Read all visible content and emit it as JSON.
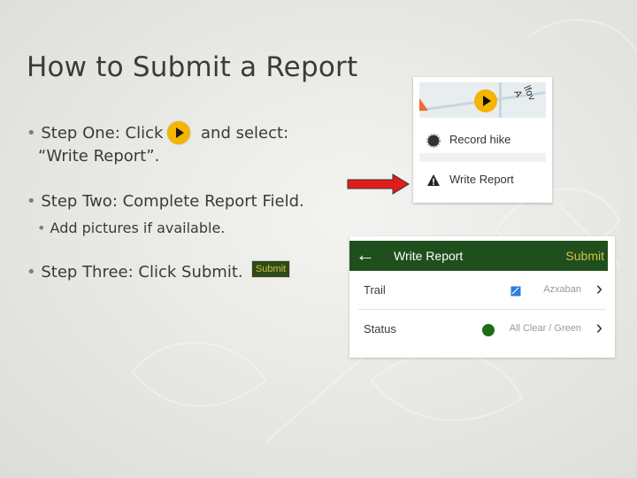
{
  "slide": {
    "title": "How to Submit a Report",
    "bullet_glyph": "•",
    "step_one_prefix": "Step One: Click",
    "step_one_suffix": "and select:",
    "step_one_line2": "“Write Report”.",
    "step_two": "Step Two: Complete Report Field.",
    "step_two_sub": "Add pictures if available.",
    "step_three": "Step Three: Click Submit.",
    "inline_submit_label": "Submit"
  },
  "map_menu": {
    "street_text": "lfov A",
    "items": [
      {
        "label": "Record hike",
        "icon": "record-icon"
      },
      {
        "label": "Write Report",
        "icon": "warning-icon"
      }
    ]
  },
  "write_report": {
    "back_glyph": "←",
    "title": "Write Report",
    "submit_label": "Submit",
    "rows": [
      {
        "label": "Trail",
        "value": "Azxaban",
        "chevron": "›"
      },
      {
        "label": "Status",
        "value": "All Clear / Green",
        "chevron": "›"
      }
    ]
  },
  "colors": {
    "accent_yellow": "#f4b400",
    "header_green": "#1f4f1c",
    "status_green": "#1e6b1a",
    "arrow_red": "#e21b1b",
    "submit_text_gold": "#d6c14a"
  }
}
